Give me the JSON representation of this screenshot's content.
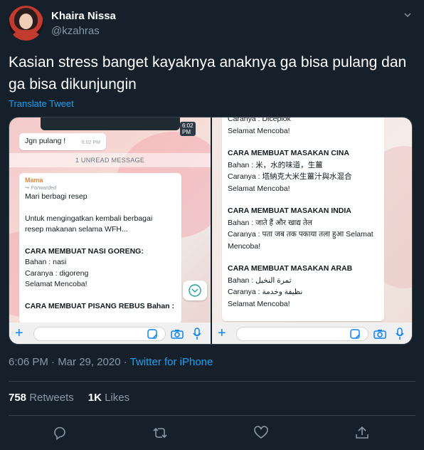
{
  "user": {
    "name": "Khaira Nissa",
    "handle": "@kzahras"
  },
  "tweet": {
    "text": "Kasian stress banget kayaknya anaknya ga bisa pulang dan ga bisa dikunjungin",
    "translate_label": "Translate Tweet"
  },
  "left_shot": {
    "top_time": "6:02 PM",
    "jgn_text": "Jgn pulang !",
    "jgn_time": "6:02 PM",
    "unread_label": "1 UNREAD MESSAGE",
    "sender": "Mama",
    "forwarded": "Forwarded",
    "lines": [
      "Mari berbagi resep",
      "",
      "Untuk mengingatkan kembali berbagai",
      "resep makanan selama WFH...",
      "",
      "CARA MEMBUAT NASI GORENG:",
      "Bahan : nasi",
      "Caranya : digoreng",
      "Selamat Mencoba!",
      "",
      "CARA MEMBUAT PISANG REBUS Bahan :"
    ]
  },
  "right_shot": {
    "lines": [
      "Caranya : Diceplok",
      "Selamat Mencoba!",
      "",
      "CARA MEMBUAT MASAKAN CINA",
      "Bahan : 米，水的味道，生薑",
      "Caranya : 塔納克大米生薑汁與水混合",
      "Selamat Mencoba!",
      "",
      "CARA MEMBUAT MASAKAN INDIA",
      "Bahan : जाते हैं और खाद्य तेल",
      "Caranya : पता जब तक पकाया तला हुआ Selamat",
      "Mencoba!",
      "",
      "CARA MEMBUAT MASAKAN ARAB",
      "Bahan : ثمرة النخيل",
      "Caranya : نظيفة وخدمة",
      "Selamat Mencoba!"
    ]
  },
  "meta": {
    "timestamp": "6:06 PM · Mar 29, 2020 · ",
    "source": "Twitter for iPhone"
  },
  "stats": {
    "retweets_count": "758",
    "retweets_label": "Retweets",
    "likes_count": "1K",
    "likes_label": "Likes"
  },
  "colors": {
    "background": "#15202b",
    "accent": "#1da1f2",
    "muted": "#8899a6",
    "divider": "#38444d"
  },
  "icons": [
    "chevron-down-icon",
    "reply-icon",
    "retweet-icon",
    "like-icon",
    "share-icon",
    "plus-icon",
    "sticker-icon",
    "camera-icon",
    "mic-icon",
    "scroll-down-icon"
  ]
}
